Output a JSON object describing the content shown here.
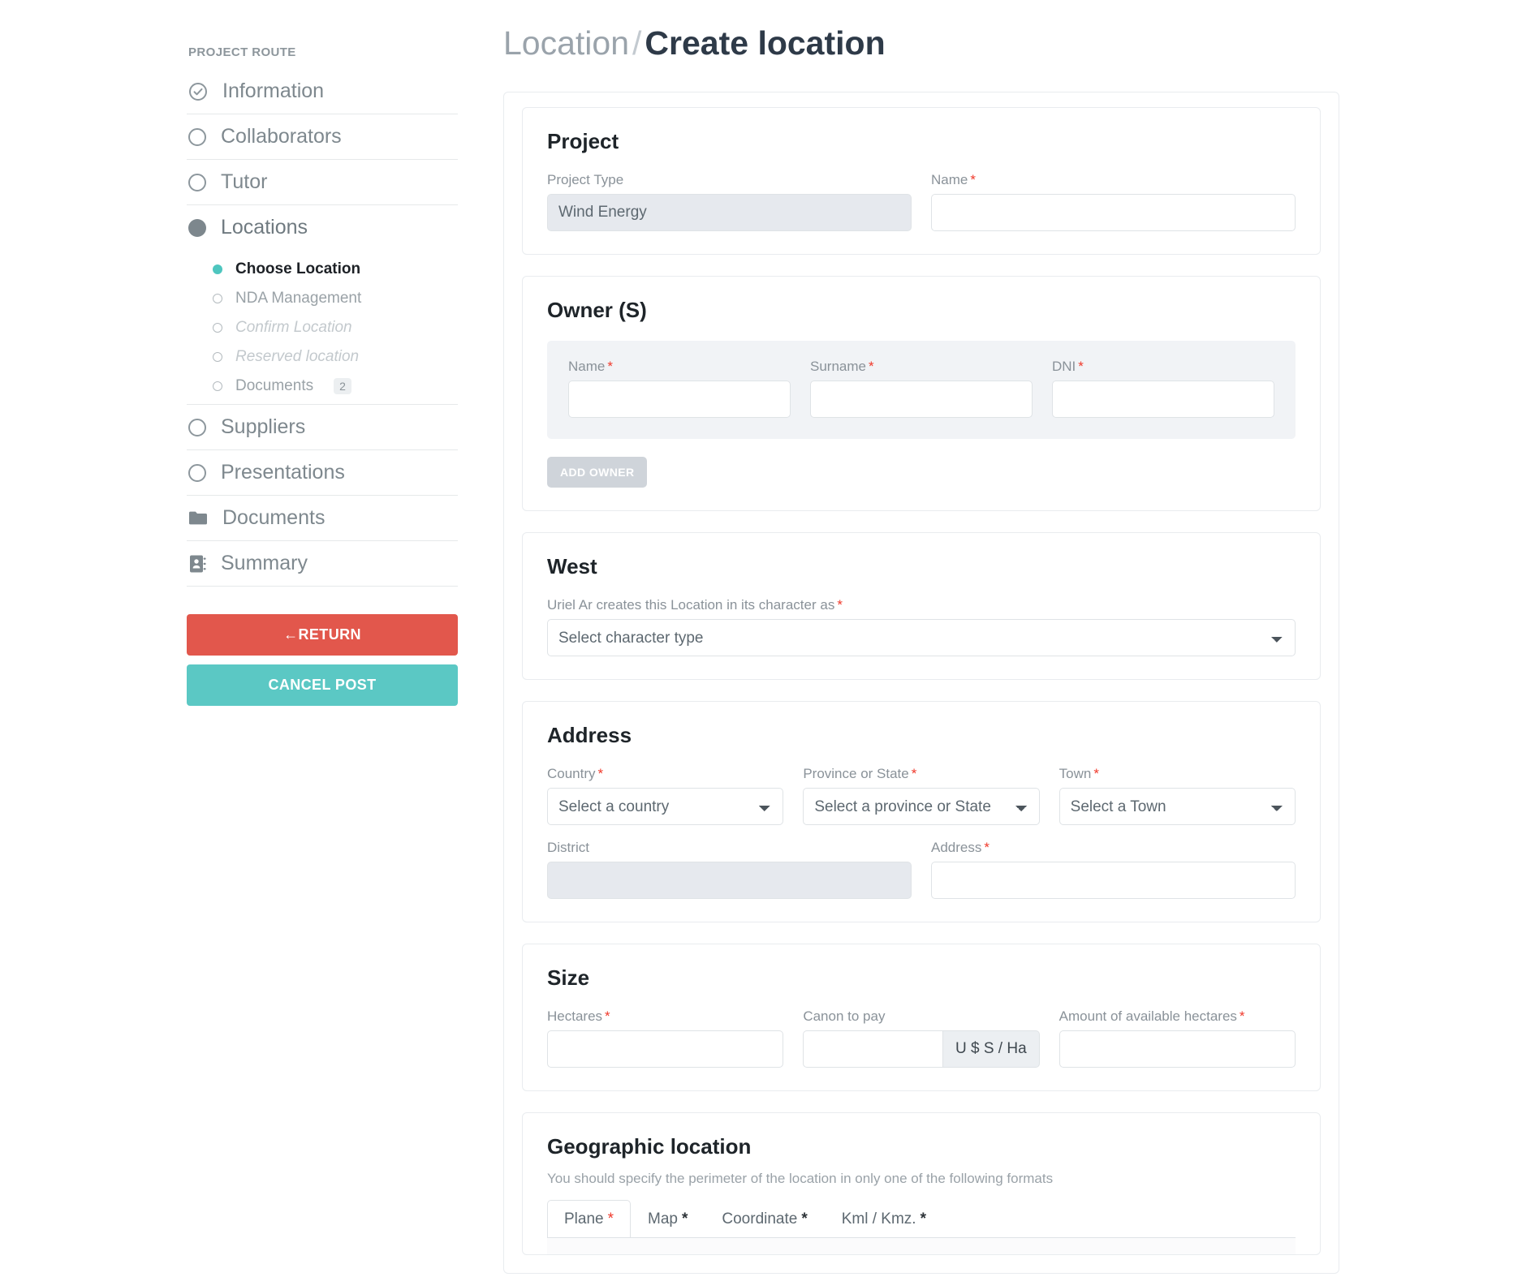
{
  "sidebar": {
    "route_title": "PROJECT ROUTE",
    "items": [
      {
        "label": "Information",
        "icon": "check-circle-icon"
      },
      {
        "label": "Collaborators",
        "icon": "circle-outline-icon"
      },
      {
        "label": "Tutor",
        "icon": "circle-outline-icon"
      },
      {
        "label": "Locations",
        "icon": "circle-filled-icon"
      },
      {
        "label": "Suppliers",
        "icon": "circle-outline-icon"
      },
      {
        "label": "Presentations",
        "icon": "circle-outline-icon"
      },
      {
        "label": "Documents",
        "icon": "folder-icon"
      },
      {
        "label": "Summary",
        "icon": "address-card-icon"
      }
    ],
    "sub_items": [
      {
        "label": "Choose Location",
        "state": "current"
      },
      {
        "label": "NDA Management",
        "state": "default"
      },
      {
        "label": "Confirm Location",
        "state": "muted"
      },
      {
        "label": "Reserved location",
        "state": "muted"
      },
      {
        "label": "Documents",
        "state": "default",
        "badge": "2"
      }
    ],
    "return_button": "RETURN",
    "cancel_button": "CANCEL POST"
  },
  "header": {
    "parent": "Location",
    "separator": "/",
    "current": "Create location"
  },
  "project": {
    "title": "Project",
    "type_label": "Project Type",
    "type_value": "Wind Energy",
    "name_label": "Name",
    "name_value": "",
    "name_placeholder": ""
  },
  "owner": {
    "title": "Owner (S)",
    "name_label": "Name",
    "surname_label": "Surname",
    "dni_label": "DNI",
    "name_value": "",
    "surname_value": "",
    "dni_value": "",
    "add_button": "ADD OWNER"
  },
  "west": {
    "title": "West",
    "character_label": "Uriel Ar creates this Location in its character as",
    "character_selected": "Select character type"
  },
  "address": {
    "title": "Address",
    "country_label": "Country",
    "country_selected": "Select a country",
    "province_label": "Province or State",
    "province_selected": "Select a province or State",
    "town_label": "Town",
    "town_selected": "Select a Town",
    "district_label": "District",
    "district_value": "",
    "address_label": "Address",
    "address_value": ""
  },
  "size": {
    "title": "Size",
    "hectares_label": "Hectares",
    "hectares_value": "",
    "canon_label": "Canon to pay",
    "canon_value": "",
    "canon_addon": "U $ S / Ha",
    "available_label": "Amount of available hectares",
    "available_value": ""
  },
  "geographic": {
    "title": "Geographic location",
    "description": "You should specify the perimeter of the location in only one of the following formats",
    "tabs": [
      {
        "label": "Plane",
        "required": "*",
        "active": true
      },
      {
        "label": "Map",
        "required": "*",
        "active": false
      },
      {
        "label": "Coordinate",
        "required": "*",
        "active": false
      },
      {
        "label": "Kml / Kmz.",
        "required": "*",
        "active": false
      }
    ]
  },
  "colors": {
    "return_red": "#e2574c",
    "cancel_teal": "#5bc8c4",
    "active_dot_teal": "#4ec6bf",
    "required_red": "#f0392b",
    "heading_dark": "#2e3a48"
  },
  "required_marker": "*"
}
